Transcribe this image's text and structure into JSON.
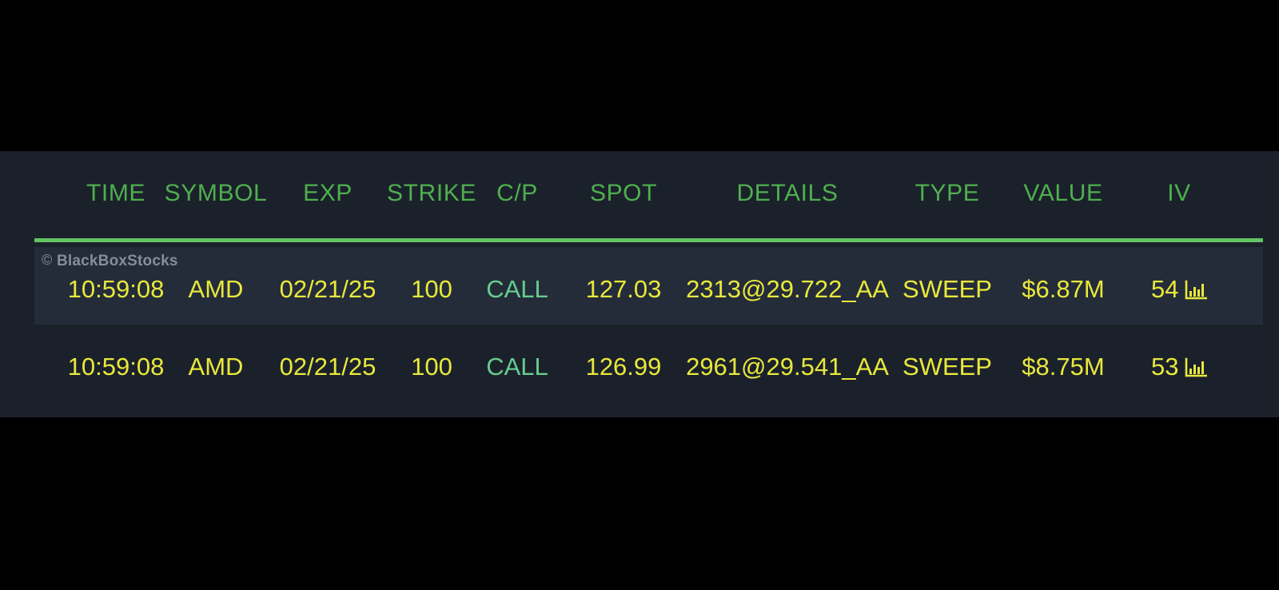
{
  "panel": {
    "name": "options-flow-table",
    "background_color": "#1b212b",
    "accent_color": "#62c462",
    "value_color": "#e8e83c",
    "cp_color": "#66cc8f",
    "header_color": "#4faf4f",
    "highlight_row_color": "#242c39"
  },
  "watermark": {
    "copyright_symbol": "©",
    "text": "BlackBoxStocks"
  },
  "table": {
    "columns": [
      {
        "key": "time",
        "label": "TIME"
      },
      {
        "key": "symbol",
        "label": "SYMBOL"
      },
      {
        "key": "exp",
        "label": "EXP"
      },
      {
        "key": "strike",
        "label": "STRIKE"
      },
      {
        "key": "cp",
        "label": "C/P"
      },
      {
        "key": "spot",
        "label": "SPOT"
      },
      {
        "key": "details",
        "label": "DETAILS"
      },
      {
        "key": "type",
        "label": "TYPE"
      },
      {
        "key": "value",
        "label": "VALUE"
      },
      {
        "key": "iv",
        "label": "IV"
      }
    ],
    "rows": [
      {
        "time": "10:59:08",
        "symbol": "AMD",
        "exp": "02/21/25",
        "strike": "100",
        "cp": "CALL",
        "spot": "127.03",
        "details": "2313@29.722_AA",
        "type": "SWEEP",
        "value": "$6.87M",
        "iv": "54",
        "iv_icon": "bar-chart-icon",
        "highlighted": true
      },
      {
        "time": "10:59:08",
        "symbol": "AMD",
        "exp": "02/21/25",
        "strike": "100",
        "cp": "CALL",
        "spot": "126.99",
        "details": "2961@29.541_AA",
        "type": "SWEEP",
        "value": "$8.75M",
        "iv": "53",
        "iv_icon": "bar-chart-icon",
        "highlighted": false
      }
    ]
  }
}
